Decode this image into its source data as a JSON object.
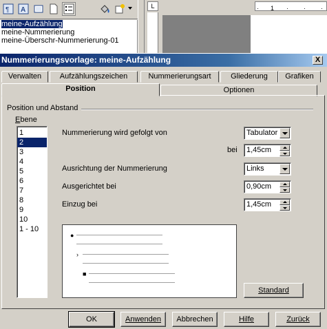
{
  "background": {
    "style_list": [
      "meine-Aufzählung",
      "meine-Nummerierung",
      "meine-Überschr-Nummerierung-01"
    ],
    "ruler_mark": "1"
  },
  "dialog": {
    "title": "Nummerierungsvorlage: meine-Aufzählung",
    "close_label": "X",
    "tabs_row1": [
      "Verwalten",
      "Aufzählungszeichen",
      "Nummerierungsart",
      "Gliederung",
      "Grafiken"
    ],
    "tabs_row2": [
      "Position",
      "Optionen"
    ],
    "section_title": "Position und Abstand",
    "level": {
      "label": "Ebene",
      "items": [
        "1",
        "2",
        "3",
        "4",
        "5",
        "6",
        "7",
        "8",
        "9",
        "10",
        "1 - 10"
      ],
      "selected": "2"
    },
    "fields": {
      "followed_by_label": "Nummerierung wird gefolgt von",
      "followed_by_value": "Tabulator",
      "at_label": "bei",
      "at_value": "1,45cm",
      "alignment_label": "Ausrichtung der Nummerierung",
      "alignment_value": "Links",
      "aligned_at_label": "Ausgerichtet bei",
      "aligned_at_value": "0,90cm",
      "indent_label": "Einzug bei",
      "indent_value": "1,45cm"
    },
    "default_button": "Standard",
    "buttons": {
      "ok": "OK",
      "apply": "Anwenden",
      "cancel": "Abbrechen",
      "help": "Hilfe",
      "back": "Zurück"
    }
  },
  "colors": {
    "selection": "#0a246a",
    "face": "#d4d0c8"
  }
}
